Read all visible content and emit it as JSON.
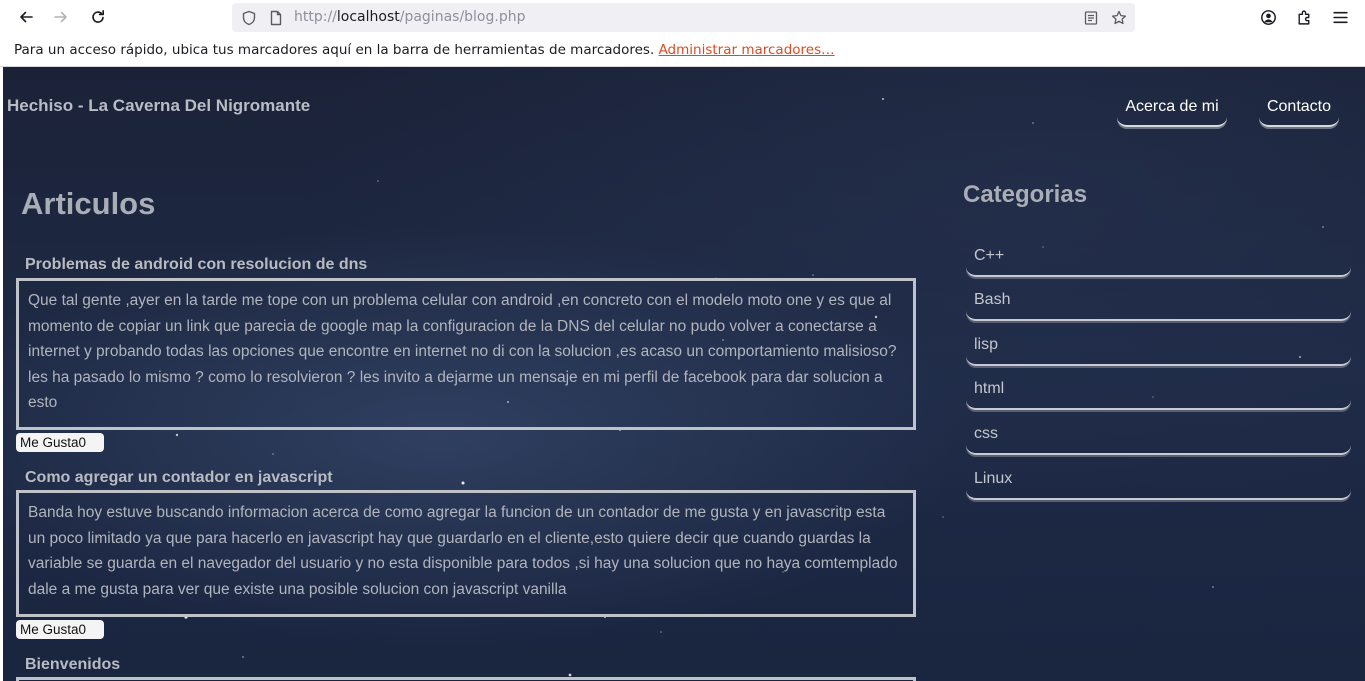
{
  "browser": {
    "url_protocol": "http://",
    "url_host": "localhost",
    "url_path": "/paginas/blog.php",
    "bookmarks_message": "Para un acceso rápido, ubica tus marcadores aquí en la barra de herramientas de marcadores.",
    "bookmarks_link": "Administrar marcadores…"
  },
  "site": {
    "title": "Hechiso - La Caverna Del Nigromante",
    "nav": {
      "about": "Acerca de mi",
      "contact": "Contacto"
    }
  },
  "articles": {
    "heading": "Articulos",
    "items": [
      {
        "title": "Problemas de android con resolucion de dns",
        "body": "Que tal gente ,ayer en la tarde me tope con un problema celular con android ,en concreto con el modelo moto one y es que al momento de copiar un link que parecia de google map la configuracion de la DNS del celular no pudo volver a conectarse a internet y probando todas las opciones que encontre en internet no di con la solucion ,es acaso un comportamiento malisioso? les ha pasado lo mismo ? como lo resolvieron ? les invito a dejarme un mensaje en mi perfil de facebook para dar solucion a esto",
        "like_label": "Me Gusta",
        "likes": "0"
      },
      {
        "title": "Como agregar un contador en javascript",
        "body": "Banda hoy estuve buscando informacion acerca de como agregar la funcion de un contador de me gusta y en javascritp esta un poco limitado ya que para hacerlo en javascript hay que guardarlo en el cliente,esto quiere decir que cuando guardas la variable se guarda en el navegador del usuario y no esta disponible para todos ,si hay una solucion que no haya comtemplado dale a me gusta para ver que existe una posible solucion con javascript vanilla",
        "like_label": "Me Gusta",
        "likes": "0"
      },
      {
        "title": "Bienvenidos"
      }
    ]
  },
  "categories": {
    "heading": "Categorias",
    "items": [
      "C++",
      "Bash",
      "lisp",
      "html",
      "css",
      "Linux"
    ]
  }
}
